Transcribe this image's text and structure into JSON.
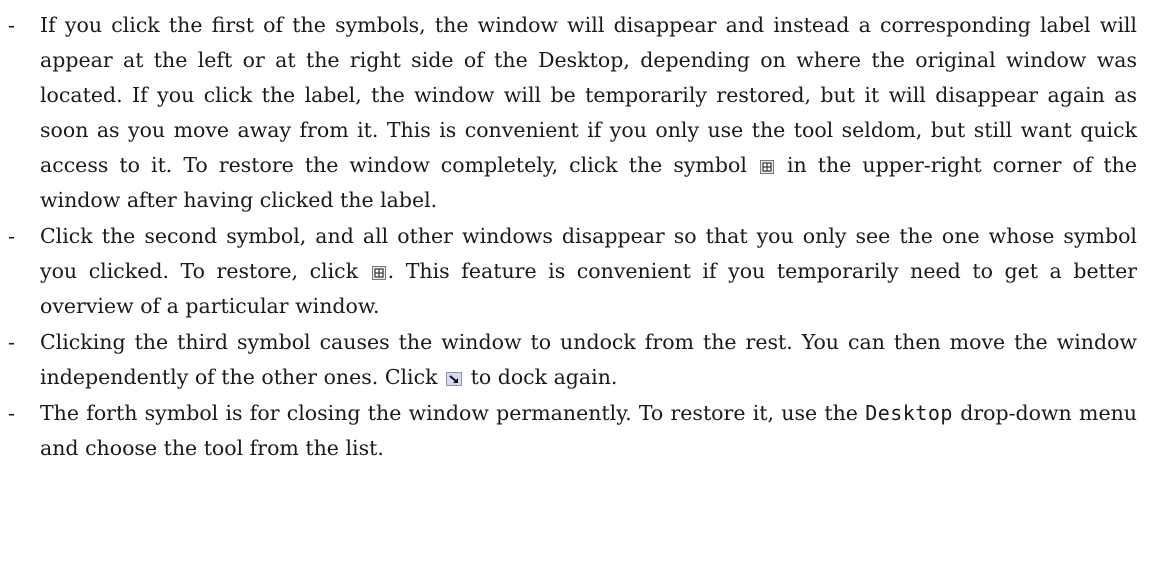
{
  "bullets": [
    {
      "dash": "-",
      "text_before_icon": "If you click the first of the symbols, the window will disappear and instead a corresponding label will appear at the left or at the right side of the Desktop, depending on where the original window was located. If you click the label, the window will be temporarily restored, but it will disappear again as soon as you move away from it. This is convenient if you only use the tool seldom, but still want quick access to it. To restore the window completely, click the symbol",
      "icon": "restore-window-icon",
      "text_after_icon": "in the upper-right corner of the window after having clicked the label."
    },
    {
      "dash": "-",
      "text_before_icon": "Click the second symbol, and all other windows disappear so that you only see the one whose symbol you clicked. To restore, click",
      "icon": "restore-window-icon",
      "text_after_icon": ". This feature is convenient if you temporarily need to get a better overview of a particular window."
    },
    {
      "dash": "-",
      "text_before_icon": "Clicking the third symbol causes the window to undock from the rest. You can then move the window independently of the other ones. Click",
      "icon": "dock-arrow-icon",
      "text_after_icon": "to dock again."
    },
    {
      "dash": "-",
      "text_before_code": "The forth symbol is for closing the window permanently. To restore it, use the",
      "code": "Desktop",
      "text_after_code": "drop-down menu and choose the tool from the list."
    }
  ]
}
